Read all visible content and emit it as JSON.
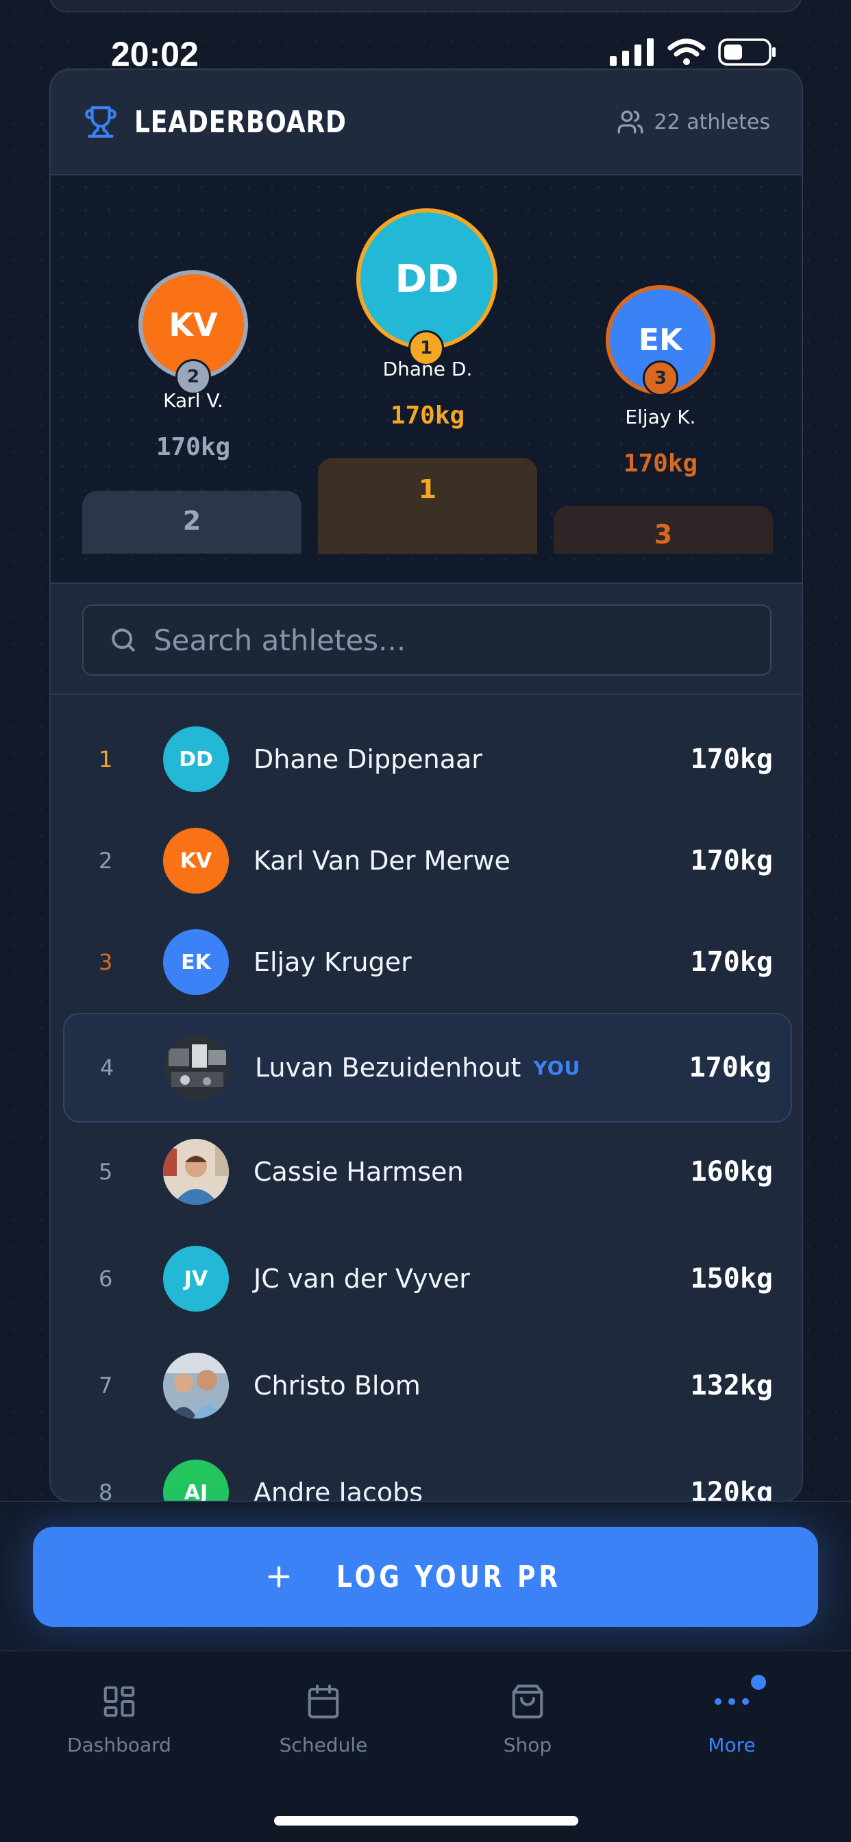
{
  "status_bar": {
    "time": "20:02"
  },
  "leaderboard": {
    "title": "LEADERBOARD",
    "athlete_count": "22 athletes",
    "icons": {
      "title": "trophy-icon",
      "count": "users-icon"
    }
  },
  "podium": [
    {
      "rank": "2",
      "initials": "KV",
      "name": "Karl V.",
      "value": "170kg",
      "color": "#f97316"
    },
    {
      "rank": "1",
      "initials": "DD",
      "name": "Dhane D.",
      "value": "170kg",
      "color": "#22b8d6"
    },
    {
      "rank": "3",
      "initials": "EK",
      "name": "Eljay K.",
      "value": "170kg",
      "color": "#3b82f6"
    }
  ],
  "search": {
    "placeholder": "Search athletes..."
  },
  "rows": [
    {
      "rank": "1",
      "initials": "DD",
      "name": "Dhane Dippenaar",
      "value": "170kg",
      "color": "#22b8d6"
    },
    {
      "rank": "2",
      "initials": "KV",
      "name": "Karl Van Der Merwe",
      "value": "170kg",
      "color": "#f97316"
    },
    {
      "rank": "3",
      "initials": "EK",
      "name": "Eljay Kruger",
      "value": "170kg",
      "color": "#3b82f6"
    },
    {
      "rank": "4",
      "initials": "",
      "name": "Luvan Bezuidenhout",
      "value": "170kg",
      "you": "YOU",
      "photo": true
    },
    {
      "rank": "5",
      "initials": "",
      "name": "Cassie Harmsen",
      "value": "160kg",
      "photo": true
    },
    {
      "rank": "6",
      "initials": "JV",
      "name": "JC van der Vyver",
      "value": "150kg",
      "color": "#22b8d6"
    },
    {
      "rank": "7",
      "initials": "",
      "name": "Christo Blom",
      "value": "132kg",
      "photo": true
    },
    {
      "rank": "8",
      "initials": "AJ",
      "name": "Andre Jacobs",
      "value": "120kg",
      "color": "#22c55e"
    }
  ],
  "colors": {
    "gold": "#f5a623",
    "silver": "#9aa7ba",
    "bronze": "#d9691f",
    "accent": "#3b82f6"
  },
  "action": {
    "label": "LOG YOUR PR",
    "icon": "plus-icon"
  },
  "nav": [
    {
      "label": "Dashboard",
      "icon": "dashboard-icon"
    },
    {
      "label": "Schedule",
      "icon": "calendar-icon"
    },
    {
      "label": "Shop",
      "icon": "shopping-bag-icon"
    },
    {
      "label": "More",
      "icon": "more-icon",
      "active": true
    }
  ]
}
